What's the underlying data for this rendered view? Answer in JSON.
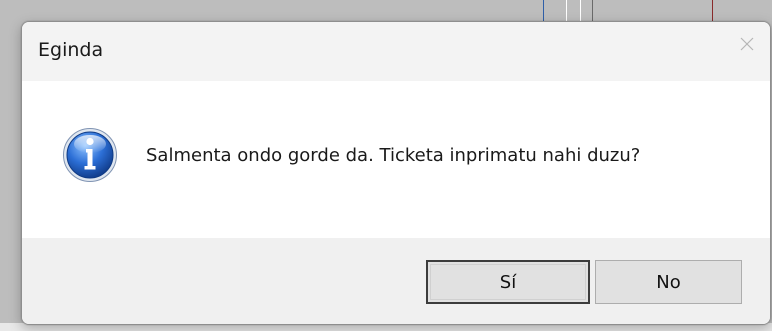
{
  "dialog": {
    "title": "Eginda",
    "message": "Salmenta ondo gorde da. Ticketa inprimatu nahi duzu?",
    "icon": "information-icon",
    "buttons": {
      "yes_label": "Sí",
      "no_label": "No"
    }
  },
  "colors": {
    "content_bg": "#ffffff",
    "footer_bg": "#f0f0f0",
    "button_bg": "#e1e1e1",
    "info_icon_blue": "#1f5fc4"
  }
}
